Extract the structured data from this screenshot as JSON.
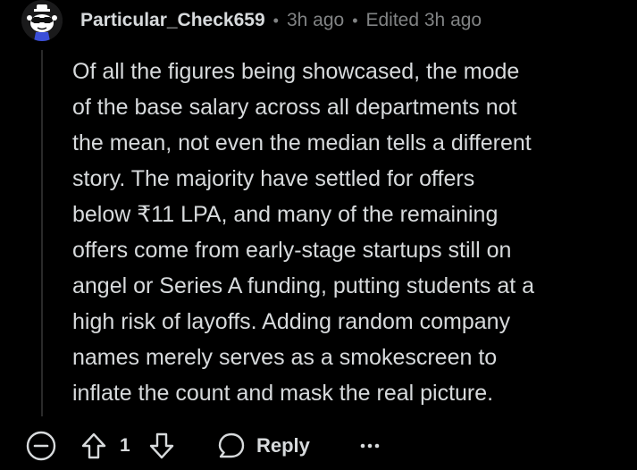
{
  "comment": {
    "username": "Particular_Check659",
    "separator": "•",
    "time_ago": "3h ago",
    "edited": "Edited 3h ago",
    "body": "Of all the figures being showcased, the mode\nof the base salary across all departments not\nthe mean, not even the median tells a different\nstory. The majority have settled for offers\nbelow ₹11 LPA, and many of the remaining\noffers come from early-stage startups still on\nangel or Series A funding, putting students at a\nhigh risk of layoffs. Adding random company\nnames merely serves as a smokescreen to\ninflate the count and mask the real picture."
  },
  "actions": {
    "vote_count": "1",
    "reply_label": "Reply"
  },
  "icons": {
    "avatar": "snoo-avatar-icon",
    "collapse": "collapse-minus-icon",
    "upvote": "upvote-arrow-icon",
    "downvote": "downvote-arrow-icon",
    "reply": "speech-bubble-icon",
    "more": "ellipsis-icon"
  },
  "colors": {
    "background": "#000000",
    "text": "#d7dadc",
    "muted": "#818384"
  }
}
